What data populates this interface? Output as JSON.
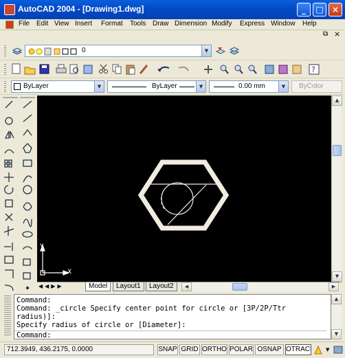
{
  "window": {
    "title": "AutoCAD 2004 - [Drawing1.dwg]",
    "min": "_",
    "max": "□",
    "close": "×"
  },
  "menu": [
    "File",
    "Edit",
    "View",
    "Insert",
    "Format",
    "Tools",
    "Draw",
    "Dimension",
    "Modify",
    "Express",
    "Window",
    "Help"
  ],
  "mdi": {
    "restore": "⧉",
    "close": "×"
  },
  "layer_combo": {
    "value": "0"
  },
  "properties": {
    "color": "ByLayer",
    "linetype": "ByLayer",
    "lineweight": "0.00 mm",
    "plotstyle": "ByColor"
  },
  "ucs": {
    "y": "Y",
    "x": "X"
  },
  "tabs": [
    "Model",
    "Layout1",
    "Layout2"
  ],
  "command_lines": [
    "Command:",
    "Command: _circle Specify center point for circle or [3P/2P/Ttr",
    "radius)]:",
    "Specify radius of circle or [Diameter]:",
    "Command:"
  ],
  "status": {
    "coords": "712.3949, 436.2175, 0.0000",
    "buttons": [
      "SNAP",
      "GRID",
      "ORTHO",
      "POLAR",
      "OSNAP",
      "OTRACK"
    ]
  },
  "colors": {
    "canvas": "#000000",
    "drawing": "#f0ece0",
    "titlebar": "#0348c4"
  }
}
